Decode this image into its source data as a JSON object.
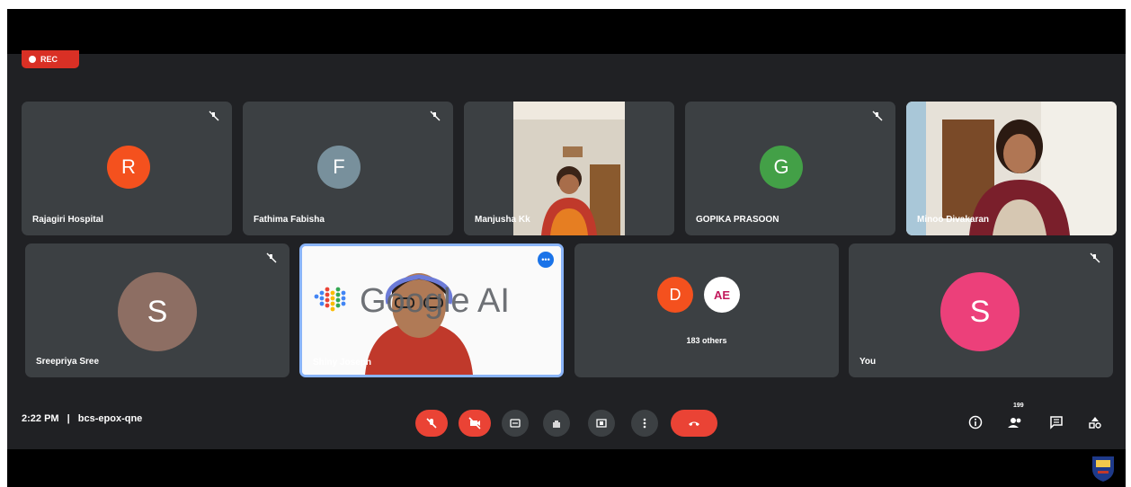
{
  "recording": {
    "label": "REC"
  },
  "participants": [
    {
      "name": "Rajagiri Hospital",
      "initial": "R",
      "color": "#f4511e"
    },
    {
      "name": "Fathima Fabisha",
      "initial": "F",
      "color": "#78909c"
    },
    {
      "name": "Manjusha Kk"
    },
    {
      "name": "GOPIKA PRASOON",
      "initial": "G",
      "color": "#43a047"
    },
    {
      "name": "Minoo Divakaran"
    },
    {
      "name": "Sreepriya Sree",
      "initial": "S",
      "color": "#8d6e63"
    },
    {
      "name": "Shiny Joseph",
      "slide_text": "Google AI"
    },
    {
      "name": "You",
      "initial": "S",
      "color": "#ec407a"
    }
  ],
  "others": {
    "label": "183 others",
    "initial": "D",
    "color": "#f4511e",
    "avatar_text": "AE"
  },
  "meeting": {
    "time": "2:22 PM",
    "separator": "|",
    "code": "bcs-epox-qne"
  },
  "people_count": "199",
  "icons": {
    "mic": "mic-off-icon",
    "camera": "camera-off-icon",
    "captions": "captions-icon",
    "hand": "raise-hand-icon",
    "present": "present-screen-icon",
    "more": "more-options-icon",
    "end": "end-call-icon",
    "info": "info-icon",
    "people": "people-icon",
    "chat": "chat-icon",
    "activities": "activities-icon"
  },
  "colors": {
    "accent": "#8ab4f8",
    "danger": "#ea4335",
    "tile": "#3c4043",
    "background": "#202124"
  }
}
